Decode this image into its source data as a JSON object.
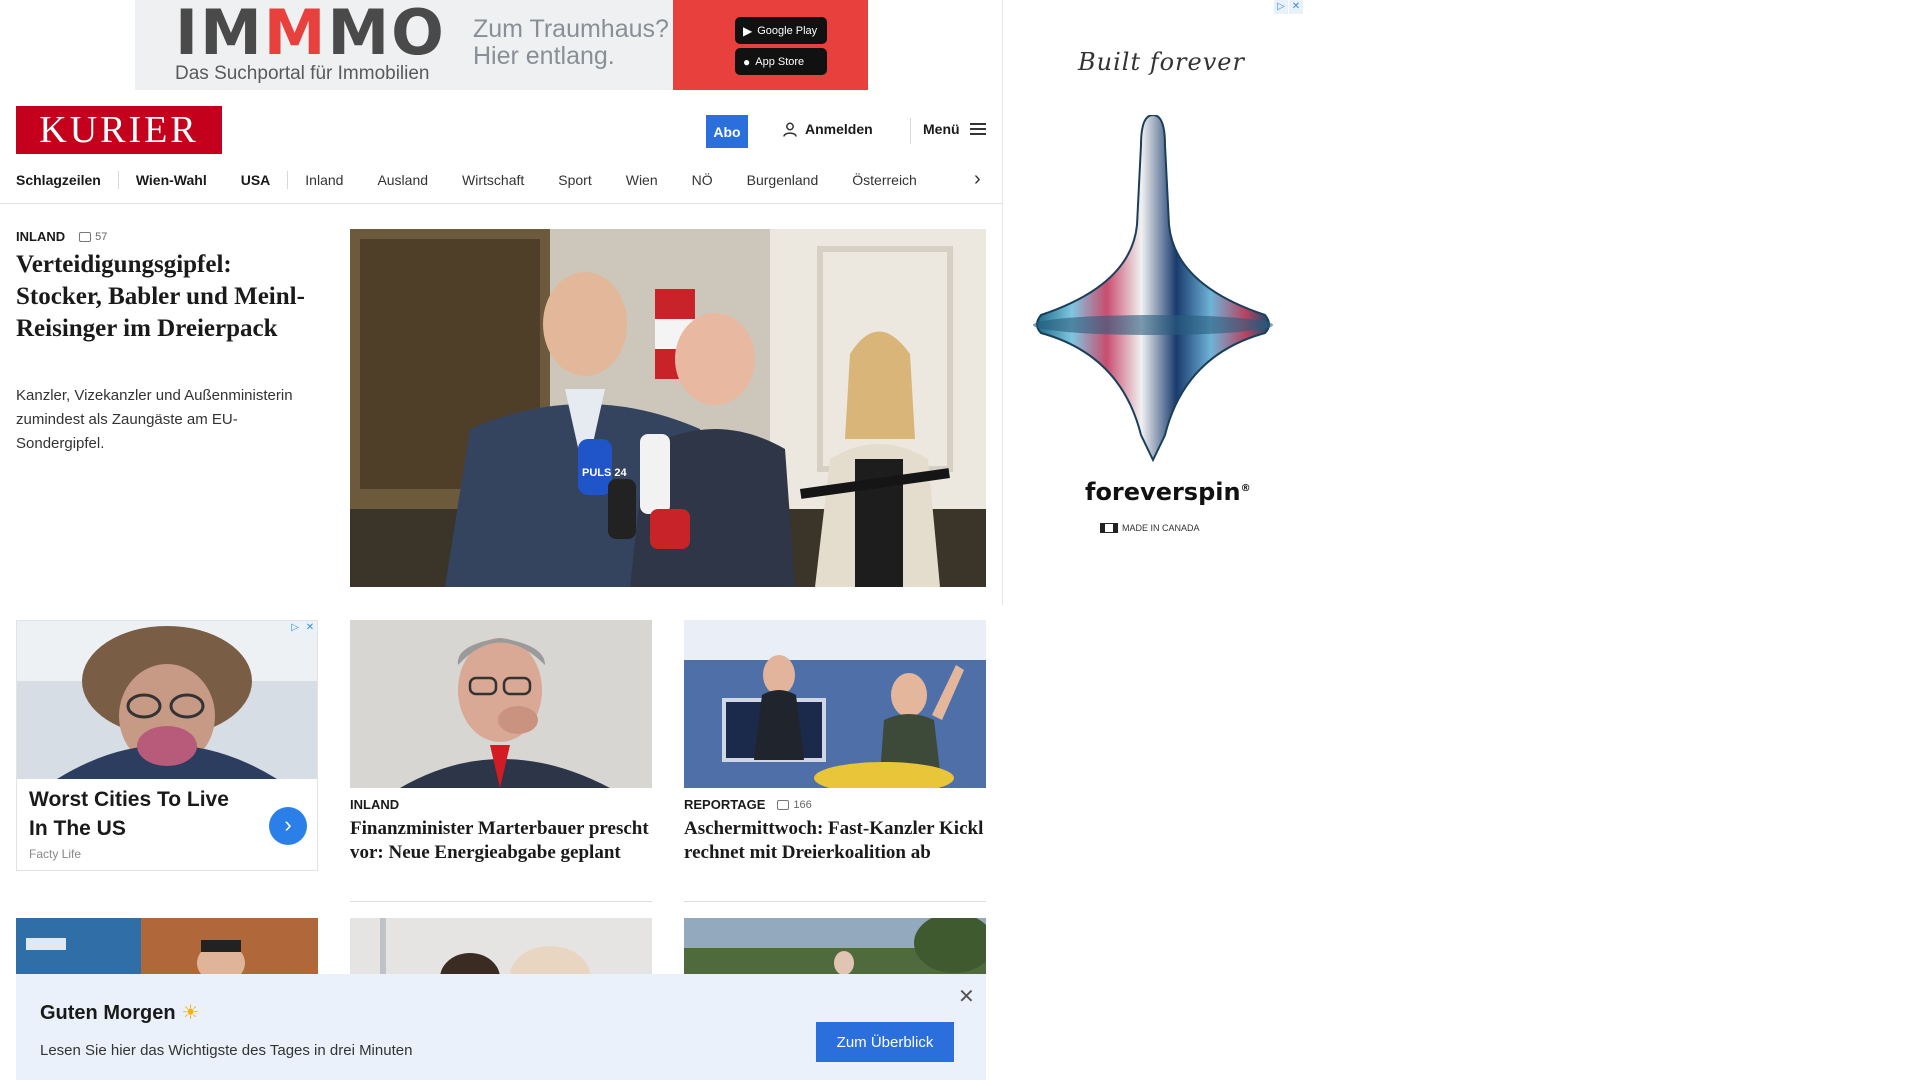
{
  "top_ad": {
    "logo_prefix": "IM",
    "logo_mid": "M",
    "logo_suffix": "MO",
    "subtitle": "Das Suchportal für Immobilien",
    "slogan": "Zum Traumhaus? Hier entlang.",
    "google_play": "Google Play",
    "app_store": "App Store"
  },
  "header": {
    "logo": "KURIER",
    "abo": "Abo",
    "login": "Anmelden",
    "menu": "Menü"
  },
  "nav": {
    "items": [
      "Schlagzeilen",
      "Wien-Wahl",
      "USA",
      "Inland",
      "Ausland",
      "Wirtschaft",
      "Sport",
      "Wien",
      "NÖ",
      "Burgenland",
      "Österreich"
    ]
  },
  "lead": {
    "kicker": "INLAND",
    "comments": "57",
    "title": "Verteidigungsgipfel: Stocker, Babler und Meinl-Reisinger im Dreierpack",
    "teaser": "Kanzler, Vizekanzler und Außenministerin zumindest als Zaungäste am EU-Sondergipfel.",
    "mic_label": "PULS 24"
  },
  "side_ad": {
    "signature": "Built forever",
    "brand": "foreverspin",
    "made_in": "MADE IN CANADA"
  },
  "ad_card": {
    "title": "Worst Cities To Live In The US",
    "source": "Facty Life"
  },
  "cards": [
    {
      "kicker": "INLAND",
      "title": "Finanzminister Marterbauer prescht vor: Neue Energieabgabe geplant"
    },
    {
      "kicker": "REPORTAGE",
      "comments": "166",
      "title": "Aschermittwoch: Fast-Kanzler Kickl rechnet mit Dreierkoalition ab"
    }
  ],
  "morning": {
    "heading": "Guten Morgen",
    "text": "Lesen Sie hier das Wichtigste des Tages in drei Minuten",
    "button": "Zum Überblick"
  },
  "colors": {
    "kurier_red": "#c4001c",
    "accent_blue": "#2a6fdb",
    "morning_bg": "#eaf1fb"
  }
}
